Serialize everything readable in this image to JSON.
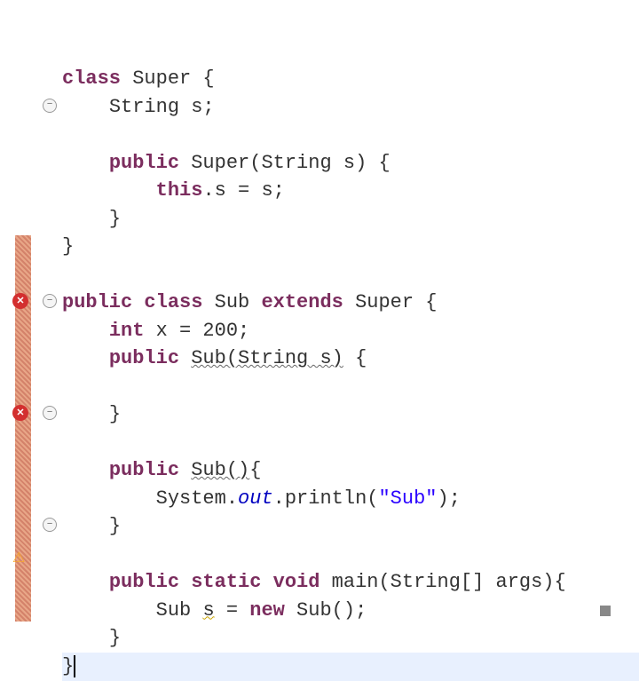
{
  "code": {
    "lines": [
      {
        "indent": 0,
        "content": [
          {
            "t": "keyword",
            "v": "class"
          },
          {
            "t": "text",
            "v": " Super {"
          }
        ]
      },
      {
        "indent": 1,
        "content": [
          {
            "t": "text",
            "v": "String s;"
          }
        ]
      },
      {
        "indent": 0,
        "content": []
      },
      {
        "indent": 1,
        "content": [
          {
            "t": "keyword",
            "v": "public"
          },
          {
            "t": "text",
            "v": " Super(String s) {"
          }
        ],
        "fold": true
      },
      {
        "indent": 2,
        "content": [
          {
            "t": "keyword",
            "v": "this"
          },
          {
            "t": "text",
            "v": ".s = s;"
          }
        ]
      },
      {
        "indent": 1,
        "content": [
          {
            "t": "text",
            "v": "}"
          }
        ]
      },
      {
        "indent": 0,
        "content": [
          {
            "t": "text",
            "v": "}"
          }
        ]
      },
      {
        "indent": 0,
        "content": []
      },
      {
        "indent": 0,
        "content": [
          {
            "t": "keyword",
            "v": "public"
          },
          {
            "t": "text",
            "v": " "
          },
          {
            "t": "keyword",
            "v": "class"
          },
          {
            "t": "text",
            "v": " Sub "
          },
          {
            "t": "keyword",
            "v": "extends"
          },
          {
            "t": "text",
            "v": " Super {"
          }
        ]
      },
      {
        "indent": 1,
        "content": [
          {
            "t": "keyword",
            "v": "int"
          },
          {
            "t": "text",
            "v": " x = 200;"
          }
        ]
      },
      {
        "indent": 1,
        "content": [
          {
            "t": "keyword",
            "v": "public"
          },
          {
            "t": "text",
            "v": " "
          },
          {
            "t": "wavy",
            "v": "Sub(String s)"
          },
          {
            "t": "text",
            "v": " {"
          }
        ],
        "fold": true,
        "error": true
      },
      {
        "indent": 0,
        "content": []
      },
      {
        "indent": 1,
        "content": [
          {
            "t": "text",
            "v": "}"
          }
        ]
      },
      {
        "indent": 0,
        "content": []
      },
      {
        "indent": 1,
        "content": [
          {
            "t": "keyword",
            "v": "public"
          },
          {
            "t": "text",
            "v": " "
          },
          {
            "t": "wavy",
            "v": "Sub()"
          },
          {
            "t": "text",
            "v": "{"
          }
        ],
        "fold": true,
        "error": true
      },
      {
        "indent": 2,
        "content": [
          {
            "t": "text",
            "v": "System."
          },
          {
            "t": "static",
            "v": "out"
          },
          {
            "t": "text",
            "v": ".println("
          },
          {
            "t": "string",
            "v": "\"Sub\""
          },
          {
            "t": "text",
            "v": ");"
          }
        ]
      },
      {
        "indent": 1,
        "content": [
          {
            "t": "text",
            "v": "}"
          }
        ]
      },
      {
        "indent": 0,
        "content": []
      },
      {
        "indent": 1,
        "content": [
          {
            "t": "keyword",
            "v": "public"
          },
          {
            "t": "text",
            "v": " "
          },
          {
            "t": "keyword",
            "v": "static"
          },
          {
            "t": "text",
            "v": " "
          },
          {
            "t": "keyword",
            "v": "void"
          },
          {
            "t": "text",
            "v": " main(String[] args){"
          }
        ],
        "fold": true
      },
      {
        "indent": 2,
        "content": [
          {
            "t": "text",
            "v": "Sub "
          },
          {
            "t": "yellow",
            "v": "s"
          },
          {
            "t": "text",
            "v": " = "
          },
          {
            "t": "keyword",
            "v": "new"
          },
          {
            "t": "text",
            "v": " Sub();"
          }
        ],
        "warning": true
      },
      {
        "indent": 1,
        "content": [
          {
            "t": "text",
            "v": "}"
          }
        ]
      },
      {
        "indent": 0,
        "content": [
          {
            "t": "text",
            "v": "}"
          },
          {
            "t": "cursor",
            "v": ""
          }
        ],
        "current": true
      }
    ]
  },
  "indentUnit": "    "
}
